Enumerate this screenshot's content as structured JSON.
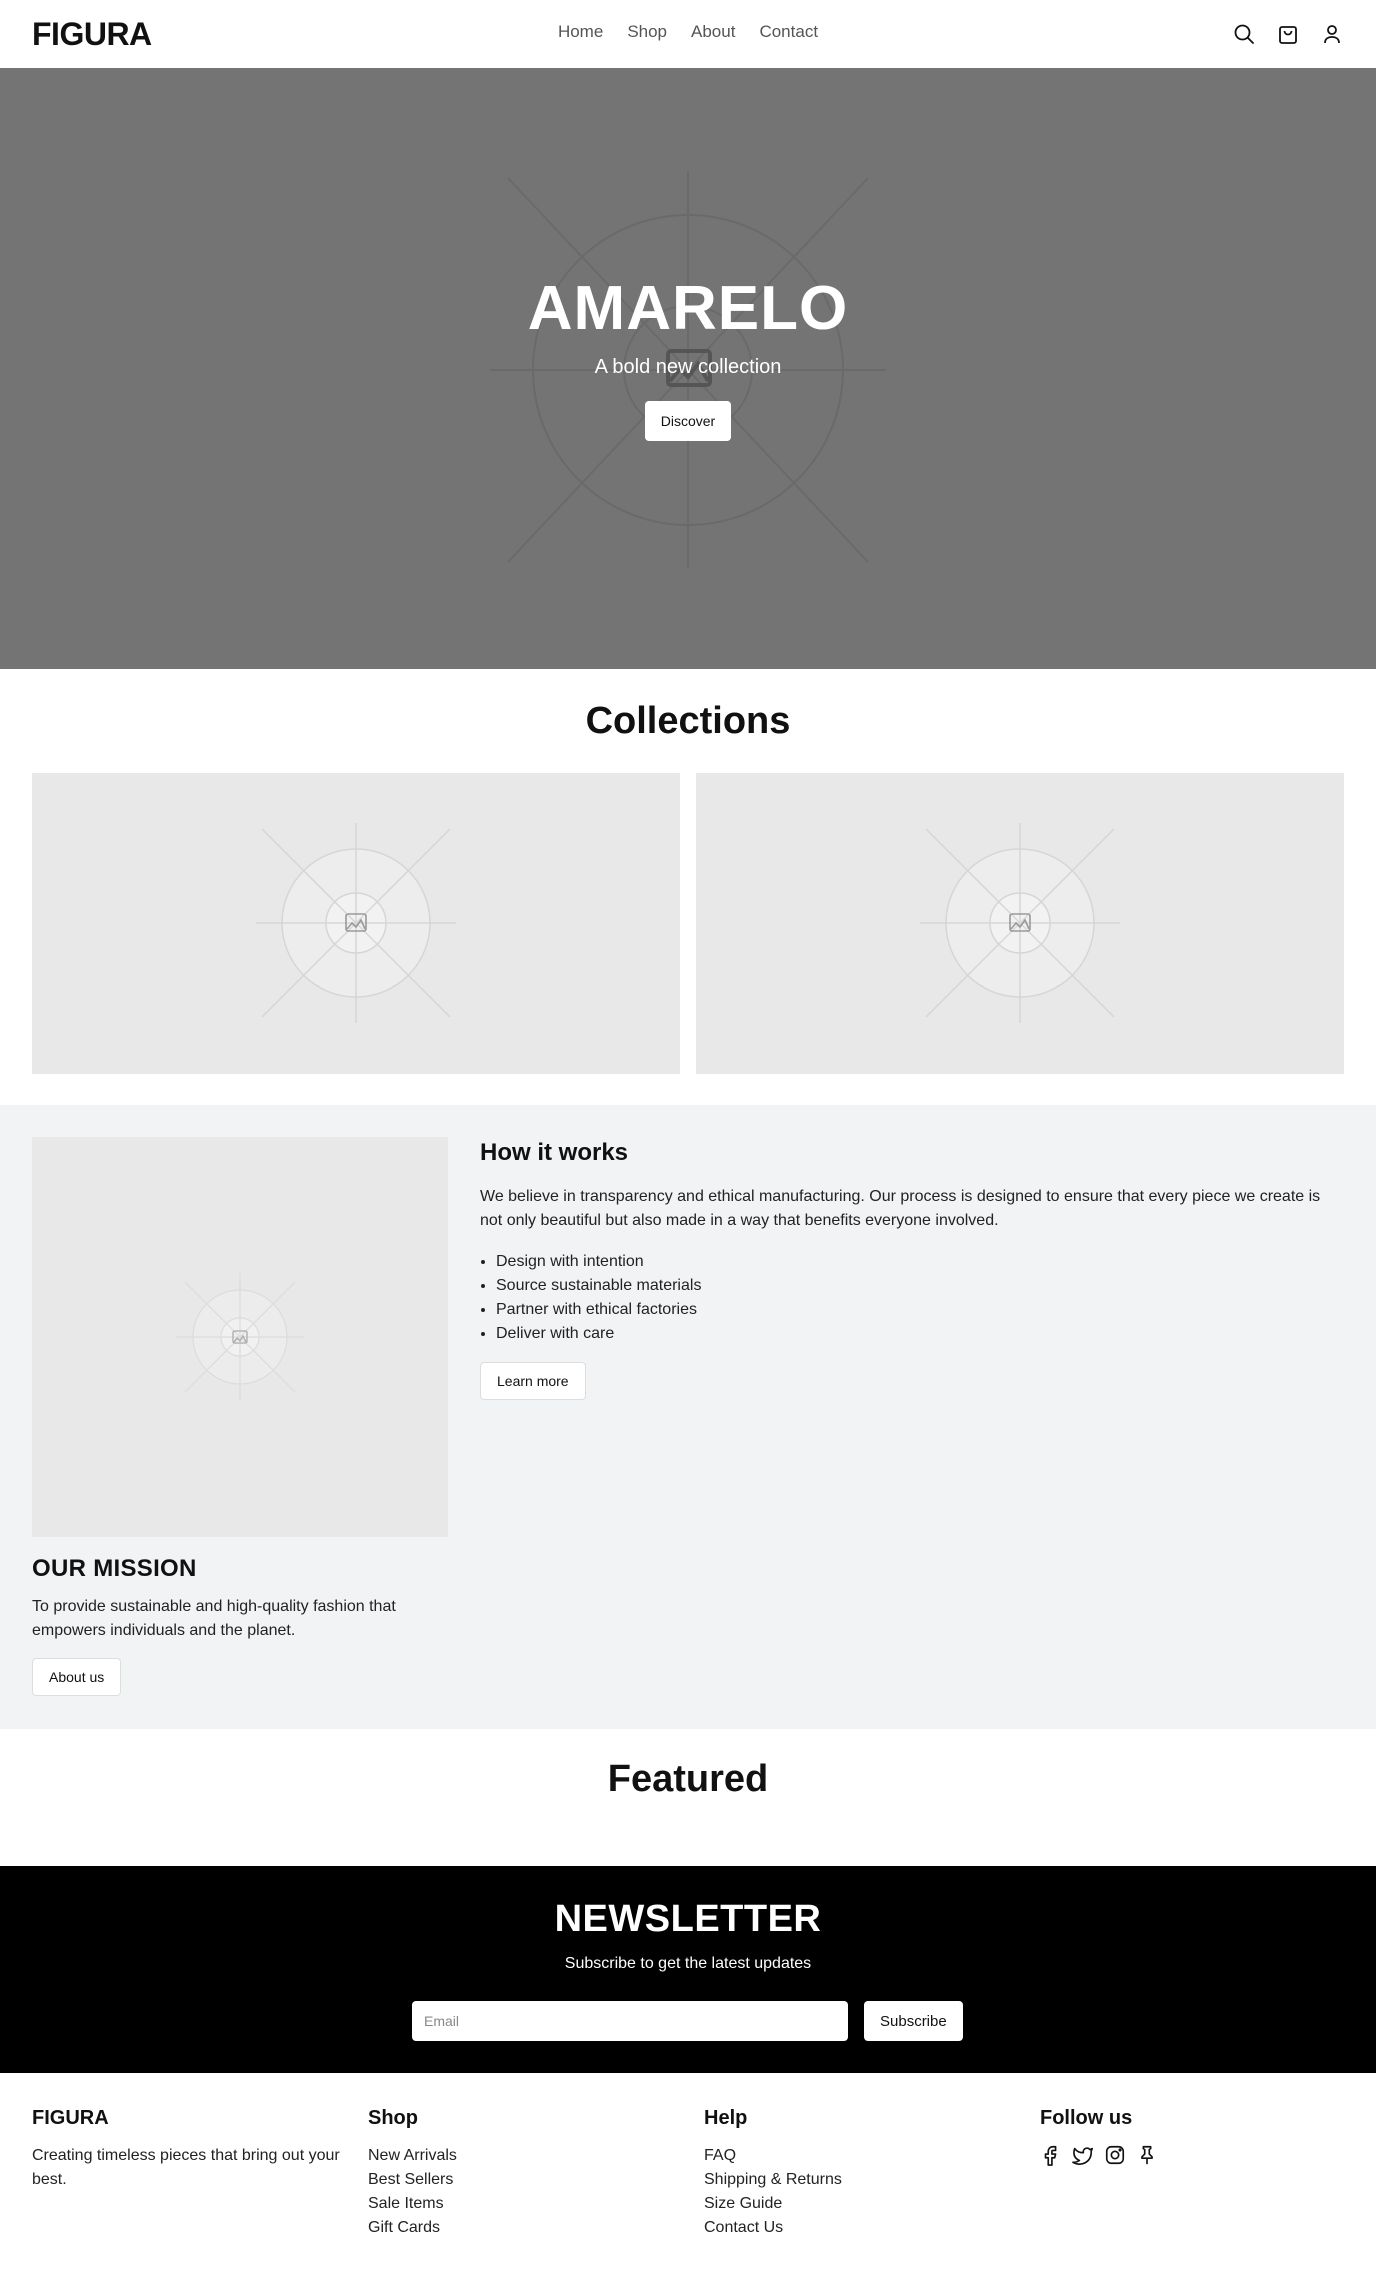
{
  "brand": "FIGURA",
  "nav": [
    "Home",
    "Shop",
    "About",
    "Contact"
  ],
  "header_icons": [
    "search-icon",
    "cart-icon",
    "user-icon"
  ],
  "hero": {
    "title": "AMARELO",
    "subtitle": "A bold new collection",
    "button": "Discover"
  },
  "collections": {
    "title": "Collections"
  },
  "how": {
    "title": "How it works",
    "text": "We believe in transparency and ethical manufacturing. Our process is designed to ensure that every piece we create is not only beautiful but also made in a way that benefits everyone involved.",
    "steps": [
      "Design with intention",
      "Source sustainable materials",
      "Partner with ethical factories",
      "Deliver with care"
    ],
    "button": "Learn more"
  },
  "mission": {
    "title": "OUR MISSION",
    "text": "To provide sustainable and high-quality fashion that empowers individuals and the planet.",
    "button": "About us"
  },
  "featured": {
    "title": "Featured"
  },
  "newsletter": {
    "title": "NEWSLETTER",
    "subtitle": "Subscribe to get the latest updates",
    "placeholder": "Email",
    "button": "Subscribe"
  },
  "footer": {
    "brand": {
      "title": "FIGURA",
      "text": "Creating timeless pieces that bring out your best."
    },
    "shop": {
      "title": "Shop",
      "links": [
        "New Arrivals",
        "Best Sellers",
        "Sale Items",
        "Gift Cards"
      ]
    },
    "help": {
      "title": "Help",
      "links": [
        "FAQ",
        "Shipping & Returns",
        "Size Guide",
        "Contact Us"
      ]
    },
    "social": {
      "title": "Follow us",
      "icons": [
        "facebook-icon",
        "twitter-icon",
        "instagram-icon",
        "pinterest-icon"
      ]
    }
  },
  "colors": {
    "hero_bg": "#747474",
    "placeholder_bg": "#e8e8e8",
    "section_bg": "#f2f3f5",
    "newsletter_bg": "#000000"
  }
}
